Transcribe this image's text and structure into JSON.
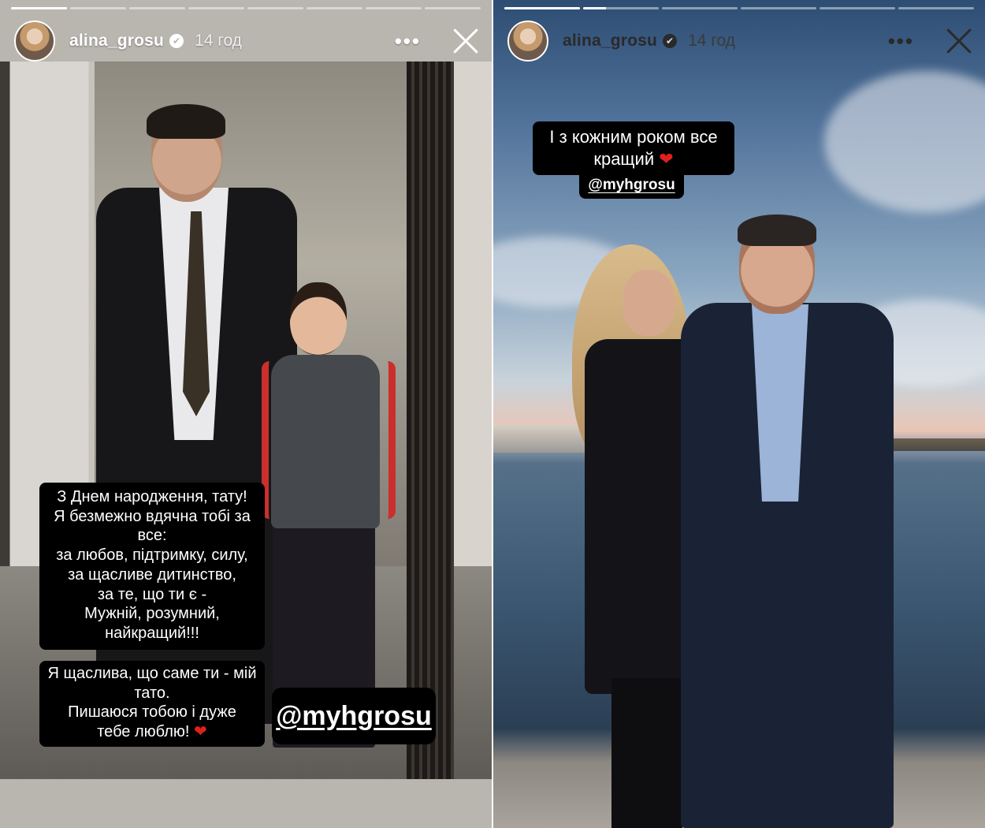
{
  "story_left": {
    "username": "alina_grosu",
    "time": "14 год",
    "verified_icon": "✔",
    "more_icon": "•••",
    "progress": [
      1.0,
      0.0,
      0.0,
      0.0,
      0.0,
      0.0,
      0.0,
      0.0
    ],
    "caption_lines": [
      "З Днем народження, тату!",
      "Я безмежно вдячна тобі за",
      "все:",
      "за любов, підтримку, силу,",
      "за щасливе дитинство,",
      "за те, що ти є -",
      "Мужній, розумний,",
      "найкращий!!!"
    ],
    "caption2_lines": [
      "Я щаслива, що саме ти - мій",
      "тато.",
      "Пишаюся тобою і дуже",
      "тебе люблю!"
    ],
    "heart": "❤",
    "mention": "@myhgrosu"
  },
  "story_right": {
    "username": "alina_grosu",
    "time": "14 год",
    "verified_icon": "✔",
    "more_icon": "•••",
    "progress": [
      1.0,
      0.3,
      0.0,
      0.0,
      0.0,
      0.0
    ],
    "caption_line1": "І з кожним роком все",
    "caption_line2": "кращий",
    "heart": "❤",
    "mention": "@myhgrosu"
  }
}
